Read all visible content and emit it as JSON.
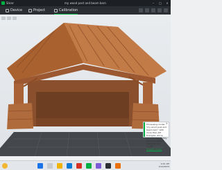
{
  "titlebar": {
    "menu_label": "Slicer",
    "document_title": "my wood post and beam barn",
    "minimize": "–",
    "maximize": "□",
    "close": "×"
  },
  "tabs": [
    {
      "label": "Device"
    },
    {
      "label": "Project"
    },
    {
      "label": "Calibration"
    }
  ],
  "notification": {
    "text": "Processing model \"my wood post and beam barn\" with more than 1M triangles, we've simplified it slightly; recommended to decimate the model.",
    "link": "Simplify model",
    "close": "×"
  },
  "taskbar": {
    "time": "9:41 AM",
    "date": "2/12/2024"
  },
  "colors": {
    "accent": "#00ae42",
    "model": "#b46a3c",
    "bed": "#44484c"
  },
  "icons": {
    "logo": "bambu-logo-icon",
    "notice_close": "close-icon"
  }
}
